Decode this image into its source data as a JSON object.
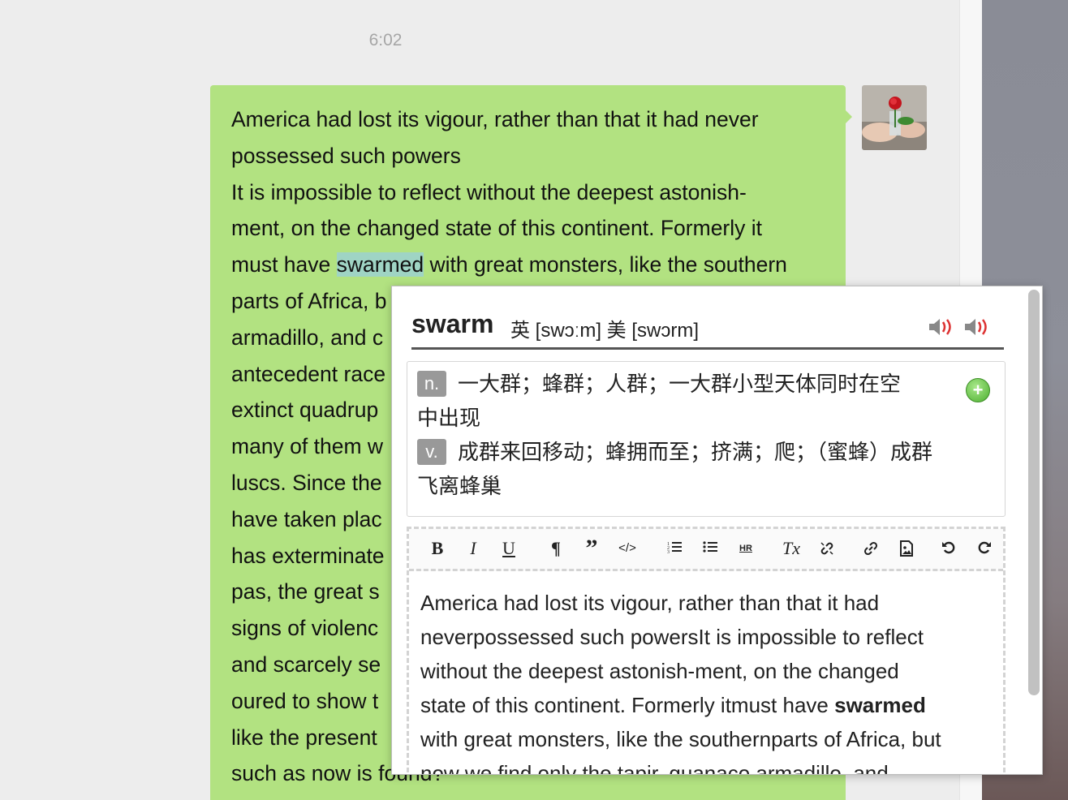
{
  "chat": {
    "timestamp": "6:02",
    "message_lines": [
      "America had lost its vigour, rather than that it had never",
      "possessed such powers",
      "It is impossible to reflect without the deepest astonish-",
      "ment, on the changed state of this continent. Formerly it",
      [
        "must have ",
        "swarmed",
        " with great monsters, like the southern"
      ],
      "parts of Africa, b",
      "armadillo, and c",
      "antecedent race",
      "extinct quadrup",
      "many of them w",
      "luscs. Since the",
      "have taken plac",
      "has exterminate",
      "pas, the great s",
      "signs of violenc",
      "and scarcely se",
      "oured to show t",
      "like the present",
      "such as now is found?"
    ]
  },
  "dictionary": {
    "headword": "swarm",
    "phonetics": "英 [swɔːm] 美 [swɔrm]",
    "definitions": [
      {
        "pos": "n.",
        "lines": [
          "一大群；蜂群；人群；一大群小型天体同时在空",
          "中出现"
        ]
      },
      {
        "pos": "v.",
        "lines": [
          "成群来回移动；蜂拥而至；挤满；爬；（蜜蜂）成群",
          "飞离蜂巢"
        ]
      }
    ],
    "add_label": "+"
  },
  "editor": {
    "toolbar": {
      "bold": "B",
      "italic": "I",
      "underline": "U",
      "paragraph": "¶",
      "quote": "”",
      "code": "</>",
      "hr": "HR",
      "clear_format": "Tx"
    },
    "lines": [
      "America had lost its vigour, rather than that it had",
      "neverpossessed such powersIt is impossible to reflect",
      "without the deepest astonish-ment, on the changed",
      [
        "state of this continent. Formerly itmust have ",
        "swarmed"
      ],
      "with great monsters, like the southernparts of Africa, but",
      "now we find only the tapir, guanaco armadillo, and"
    ]
  },
  "colors": {
    "bubble": "#b2e281",
    "highlight": "#9fd4c4",
    "background": "#ededed"
  }
}
